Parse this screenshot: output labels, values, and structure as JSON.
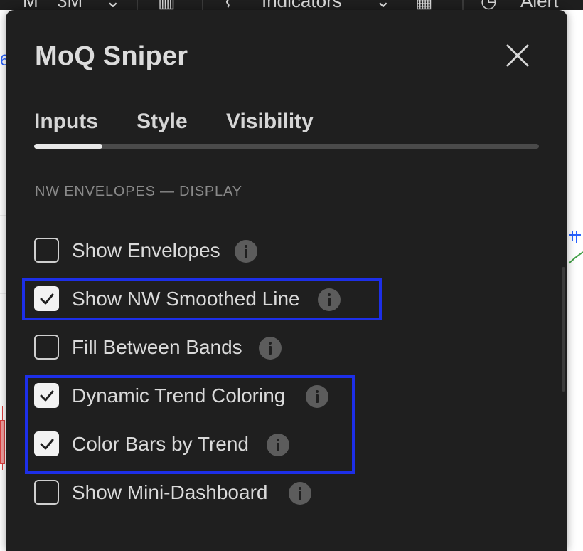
{
  "toolbar": {
    "symbol_fragment": "M",
    "timeframe": "3M",
    "indicators_label": "Indicators",
    "alert_label": "Alert"
  },
  "chart": {
    "left_price_fragment": "6"
  },
  "dialog": {
    "title": "MoQ Sniper",
    "tabs": [
      {
        "label": "Inputs",
        "active": true
      },
      {
        "label": "Style",
        "active": false
      },
      {
        "label": "Visibility",
        "active": false
      }
    ],
    "section": "NW ENVELOPES — DISPLAY",
    "options": [
      {
        "label": "Show Envelopes",
        "checked": false
      },
      {
        "label": "Show NW Smoothed Line",
        "checked": true
      },
      {
        "label": "Fill Between Bands",
        "checked": false
      },
      {
        "label": "Dynamic Trend Coloring",
        "checked": true
      },
      {
        "label": "Color Bars by Trend",
        "checked": true
      },
      {
        "label": "Show Mini-Dashboard",
        "checked": false
      }
    ]
  },
  "colors": {
    "dialog_bg": "#1f1f1f",
    "text": "#dadada",
    "highlight": "#1d2fe8",
    "check_fill": "#f2f2f2"
  }
}
